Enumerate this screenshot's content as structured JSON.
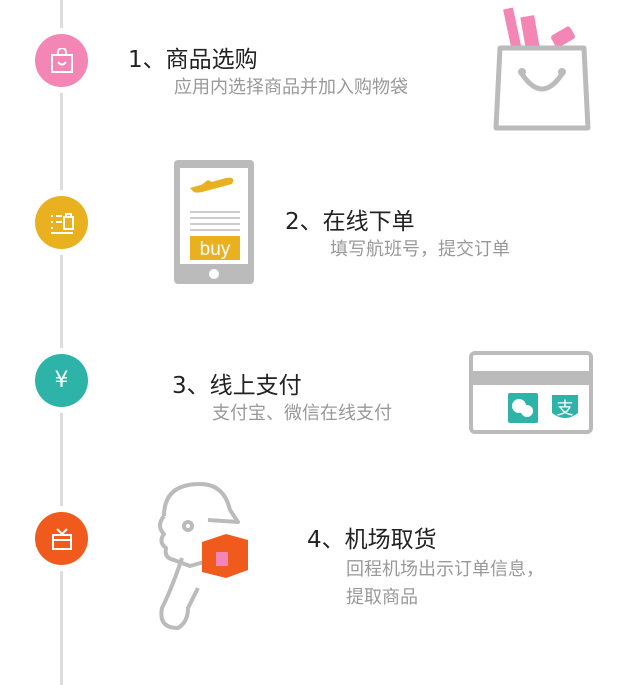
{
  "steps": [
    {
      "title": "1、商品选购",
      "subtitle": "应用内选择商品并加入购物袋",
      "icon": "shopping-bag-icon",
      "color": "#f386b4"
    },
    {
      "title": "2、在线下单",
      "subtitle": "填写航班号，提交订单",
      "icon": "order-list-icon",
      "color": "#e9b020",
      "illustration_label": "buy"
    },
    {
      "title": "3、线上支付",
      "subtitle": "支付宝、微信在线支付",
      "icon": "yen-icon",
      "icon_glyph": "¥",
      "color": "#2db3a7"
    },
    {
      "title": "4、机场取货",
      "subtitle_lines": [
        "回程机场出示订单信息，",
        "提取商品"
      ],
      "icon": "gift-icon",
      "color": "#f05a1c"
    }
  ],
  "alipay_glyph": "支"
}
